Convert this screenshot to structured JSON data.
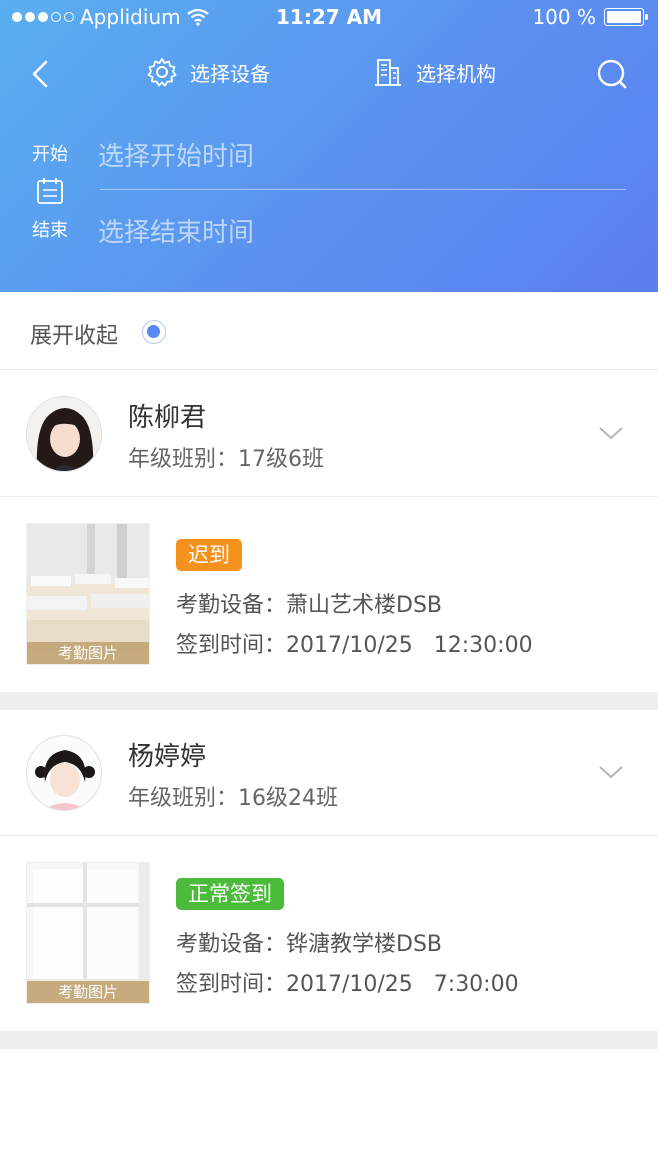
{
  "status_bar": {
    "carrier": "Applidium",
    "time": "11:27 AM",
    "battery": "100 %"
  },
  "nav": {
    "device_label": "选择设备",
    "org_label": "选择机构"
  },
  "time_filter": {
    "start_label": "开始",
    "start_placeholder": "选择开始时间",
    "end_label": "结束",
    "end_placeholder": "选择结束时间"
  },
  "toggle": {
    "label": "展开收起"
  },
  "records": [
    {
      "name": "陈柳君",
      "grade": "年级班别：17级6班",
      "status": "迟到",
      "status_color": "#f5921e",
      "device": "考勤设备：萧山艺术楼DSB",
      "time": "签到时间：2017/10/25   12:30:00",
      "photo_caption": "考勤图片"
    },
    {
      "name": "杨婷婷",
      "grade": "年级班别：16级24班",
      "status": "正常签到",
      "status_color": "#4cbb3c",
      "device": "考勤设备：铧溏教学楼DSB",
      "time": "签到时间：2017/10/25   7:30:00",
      "photo_caption": "考勤图片"
    }
  ],
  "colors": {
    "header_start": "#5aaff0",
    "header_end": "#5b7ff0",
    "accent": "#5b87f0"
  }
}
